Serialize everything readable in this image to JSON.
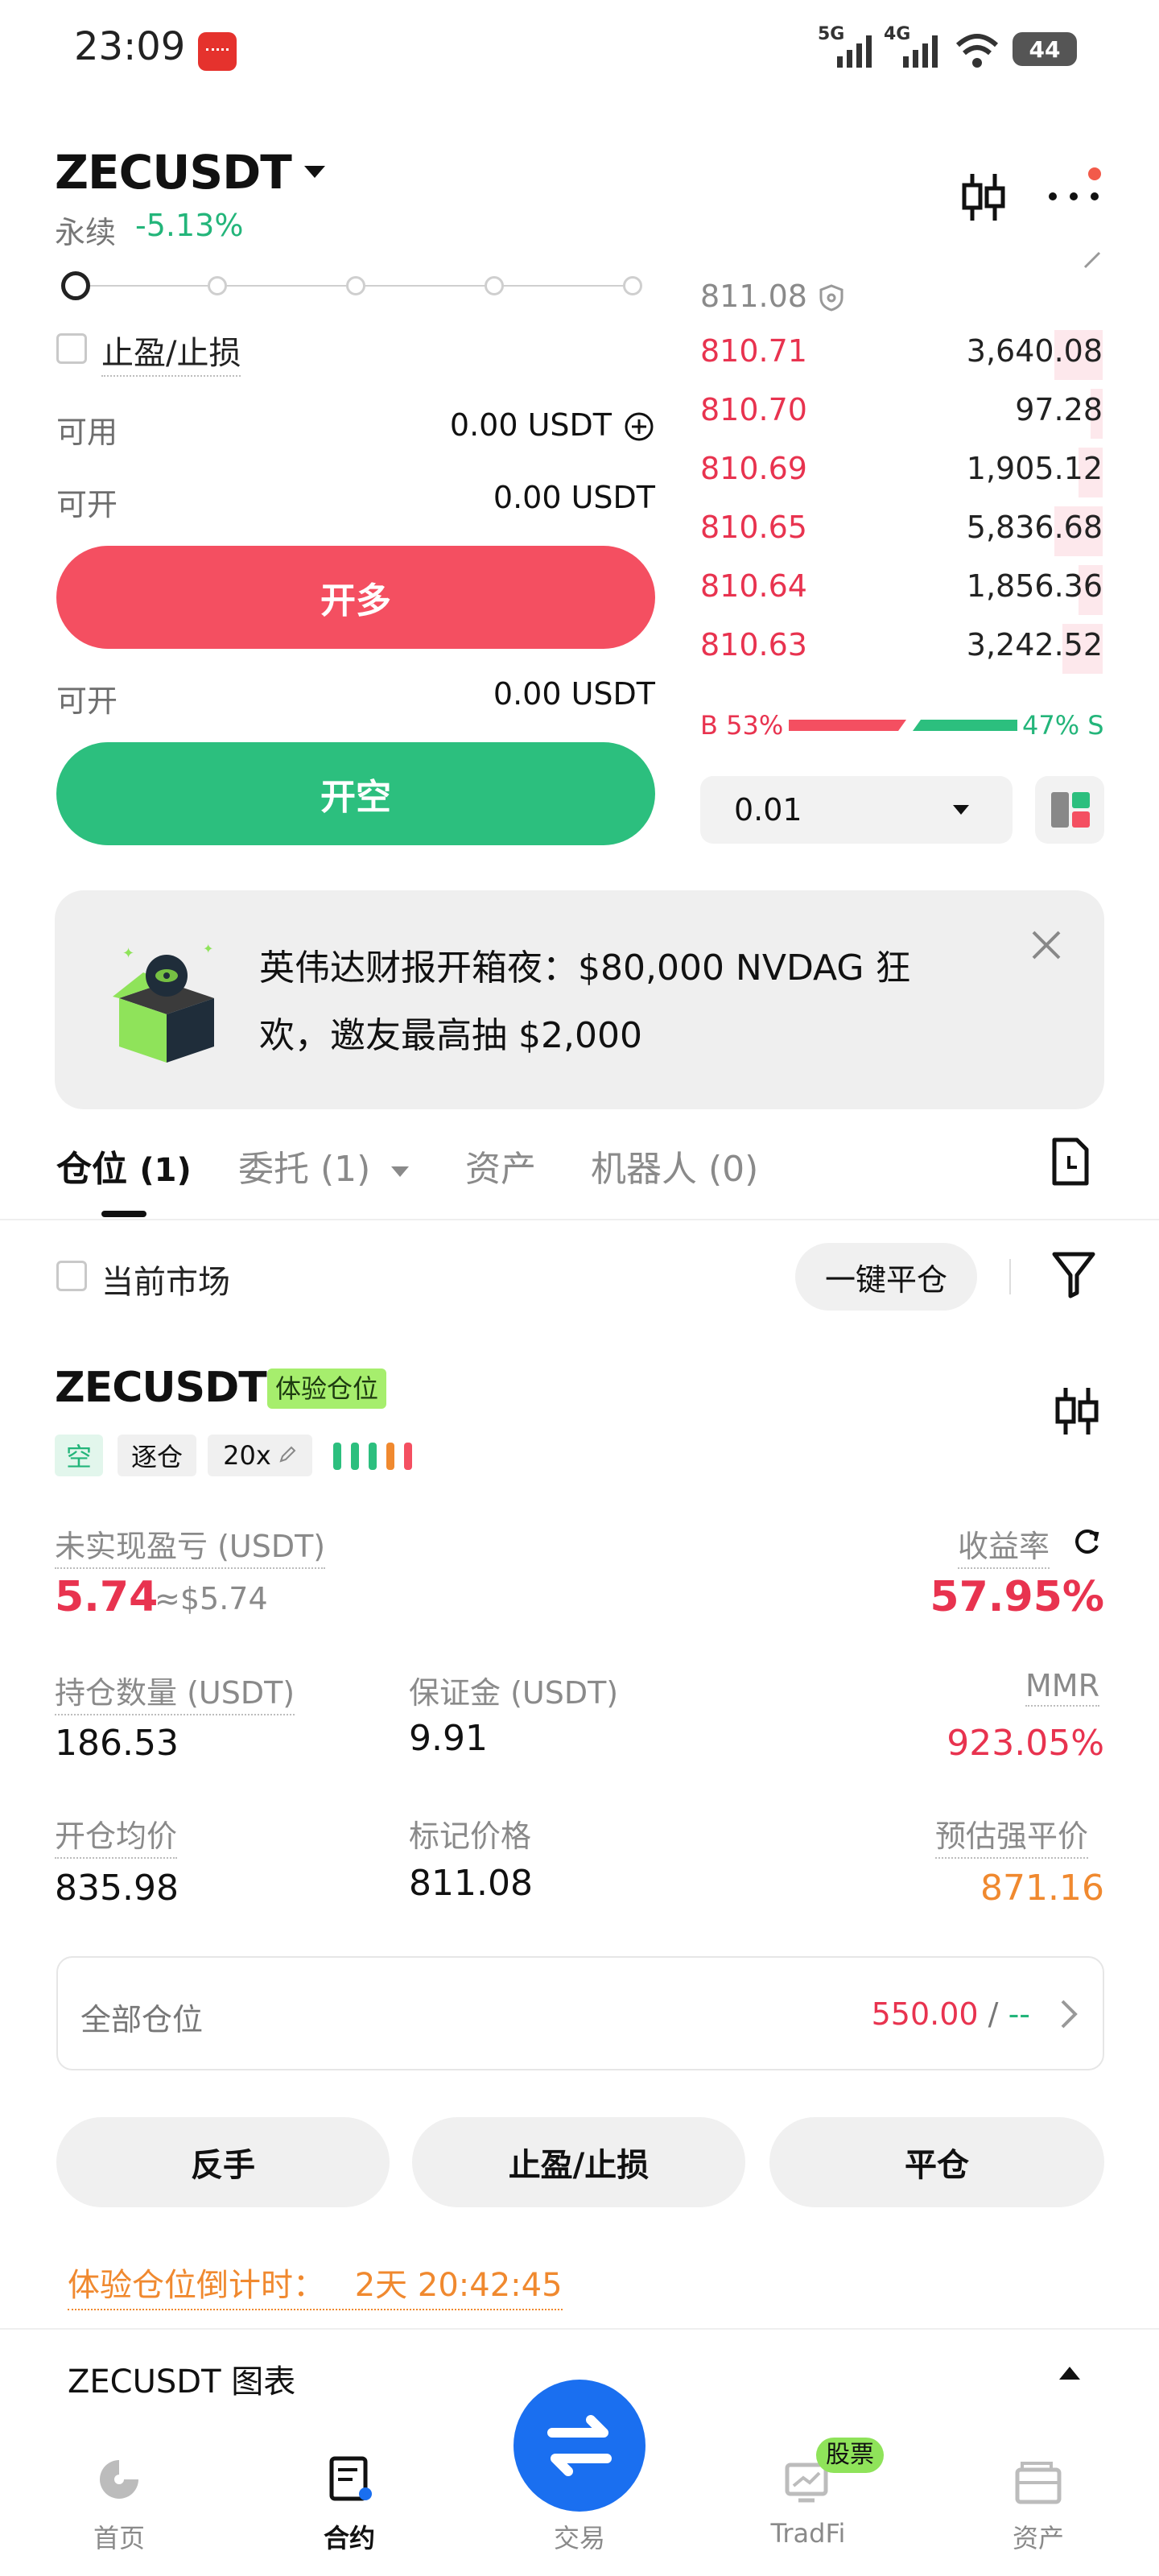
{
  "status_bar": {
    "time": "23:09",
    "network1": "5G",
    "network2": "4G",
    "battery": "44"
  },
  "header": {
    "pair": "ZECUSDT",
    "type": "永续",
    "change": "-5.13%"
  },
  "order_form": {
    "tp_sl_label": "止盈/止损",
    "available_label": "可用",
    "available_value": "0.00 USDT",
    "can_open_label": "可开",
    "can_open_long_value": "0.00 USDT",
    "open_long": "开多",
    "can_open_short_value": "0.00 USDT",
    "open_short": "开空"
  },
  "order_book": {
    "last_price": "811.08",
    "asks": [
      {
        "price": "810.71",
        "qty": "3,640.08",
        "depth": 0.12
      },
      {
        "price": "810.70",
        "qty": "97.28",
        "depth": 0.03
      },
      {
        "price": "810.69",
        "qty": "1,905.12",
        "depth": 0.06
      },
      {
        "price": "810.65",
        "qty": "5,836.68",
        "depth": 0.12
      },
      {
        "price": "810.64",
        "qty": "1,856.36",
        "depth": 0.06
      },
      {
        "price": "810.63",
        "qty": "3,242.52",
        "depth": 0.1
      }
    ],
    "buy_ratio": "B 53%",
    "sell_ratio": "47% S",
    "buy_fraction": 0.53,
    "precision": "0.01"
  },
  "banner": {
    "text_line1": "英伟达财报开箱夜：$80,000 NVDAG 狂",
    "text_line2": "欢，邀友最高抽 $2,000"
  },
  "tabs": {
    "positions": "仓位",
    "positions_count": "(1)",
    "orders": "委托 (1)",
    "assets": "资产",
    "bots": "机器人 (0)"
  },
  "filter": {
    "current_market": "当前市场",
    "close_all": "一键平仓"
  },
  "position": {
    "symbol": "ZECUSDT",
    "trial_badge": "体验仓位",
    "side": "空",
    "margin_mode": "逐仓",
    "leverage": "20x",
    "unrealized_pnl_label": "未实现盈亏 (USDT)",
    "unrealized_pnl": "5.74",
    "unrealized_pnl_usd": "≈$5.74",
    "roe_label": "收益率",
    "roe": "57.95%",
    "size_label": "持仓数量 (USDT)",
    "size": "186.53",
    "margin_label": "保证金 (USDT)",
    "margin": "9.91",
    "mmr_label": "MMR",
    "mmr": "923.05%",
    "entry_label": "开仓均价",
    "entry": "835.98",
    "mark_label": "标记价格",
    "mark": "811.08",
    "liq_label": "预估强平价",
    "liq": "871.16",
    "all_positions_label": "全部仓位",
    "all_positions_value": "550.00",
    "all_positions_sep": " / ",
    "all_positions_tail": "--",
    "btn_reverse": "反手",
    "btn_tpsl": "止盈/止损",
    "btn_close": "平仓",
    "countdown_label": "体验仓位倒计时：",
    "countdown_value": "2天 20:42:45"
  },
  "chart_bar": {
    "label": "ZECUSDT 图表"
  },
  "bottom_nav": {
    "home": "首页",
    "futures": "合约",
    "trade": "交易",
    "tradfi": "TradFi",
    "tradfi_badge": "股票",
    "assets": "资产"
  },
  "colors": {
    "red": "#e8334f",
    "green": "#23b57a",
    "orange": "#f0892f",
    "blue": "#1a6ff0"
  }
}
